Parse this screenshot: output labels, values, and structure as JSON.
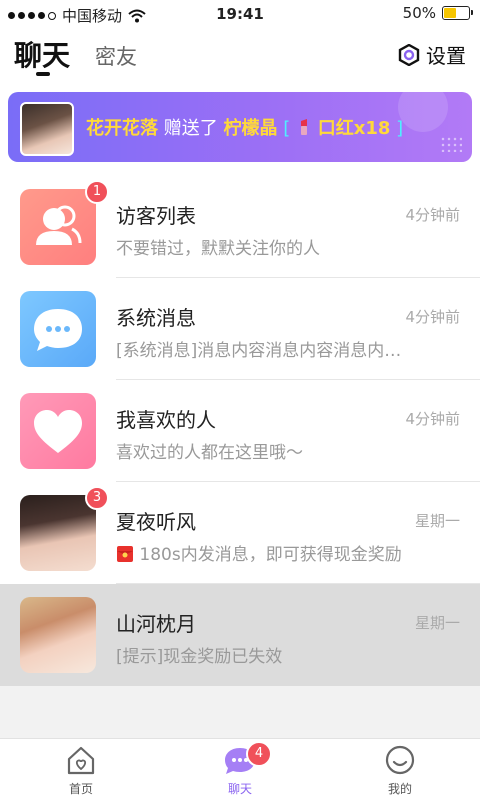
{
  "status": {
    "carrier": "中国移动",
    "time": "19:41",
    "battery": "50%"
  },
  "header": {
    "tab_active": "聊天",
    "tab_other": "密友",
    "settings_label": "设置"
  },
  "banner": {
    "sender": "花开花落",
    "action": "赠送了",
    "receiver": "柠檬晶",
    "gift_open": "[",
    "gift_name": "口红x18",
    "gift_close": "]"
  },
  "list": [
    {
      "title": "访客列表",
      "time": "4分钟前",
      "subtitle": "不要错过，默默关注你的人",
      "badge": "1",
      "icon": "visitor-icon"
    },
    {
      "title": "系统消息",
      "time": "4分钟前",
      "subtitle": "[系统消息]消息内容消息内容消息内…",
      "icon": "chat-bubble-icon"
    },
    {
      "title": "我喜欢的人",
      "time": "4分钟前",
      "subtitle": "喜欢过的人都在这里哦～",
      "icon": "heart-icon"
    },
    {
      "title": "夏夜听风",
      "time": "星期一",
      "subtitle": "180s内发消息，即可获得现金奖励",
      "badge": "3",
      "icon": "avatar"
    },
    {
      "title": "山河枕月",
      "time": "星期一",
      "subtitle": "[提示]现金奖励已失效",
      "icon": "avatar"
    }
  ],
  "tabbar": {
    "home": "首页",
    "chat": "聊天",
    "chat_badge": "4",
    "mine": "我的"
  },
  "colors": {
    "accent": "#8a63f0",
    "badge": "#f0505a",
    "banner_start": "#7a6df7",
    "banner_end": "#b27af6"
  }
}
